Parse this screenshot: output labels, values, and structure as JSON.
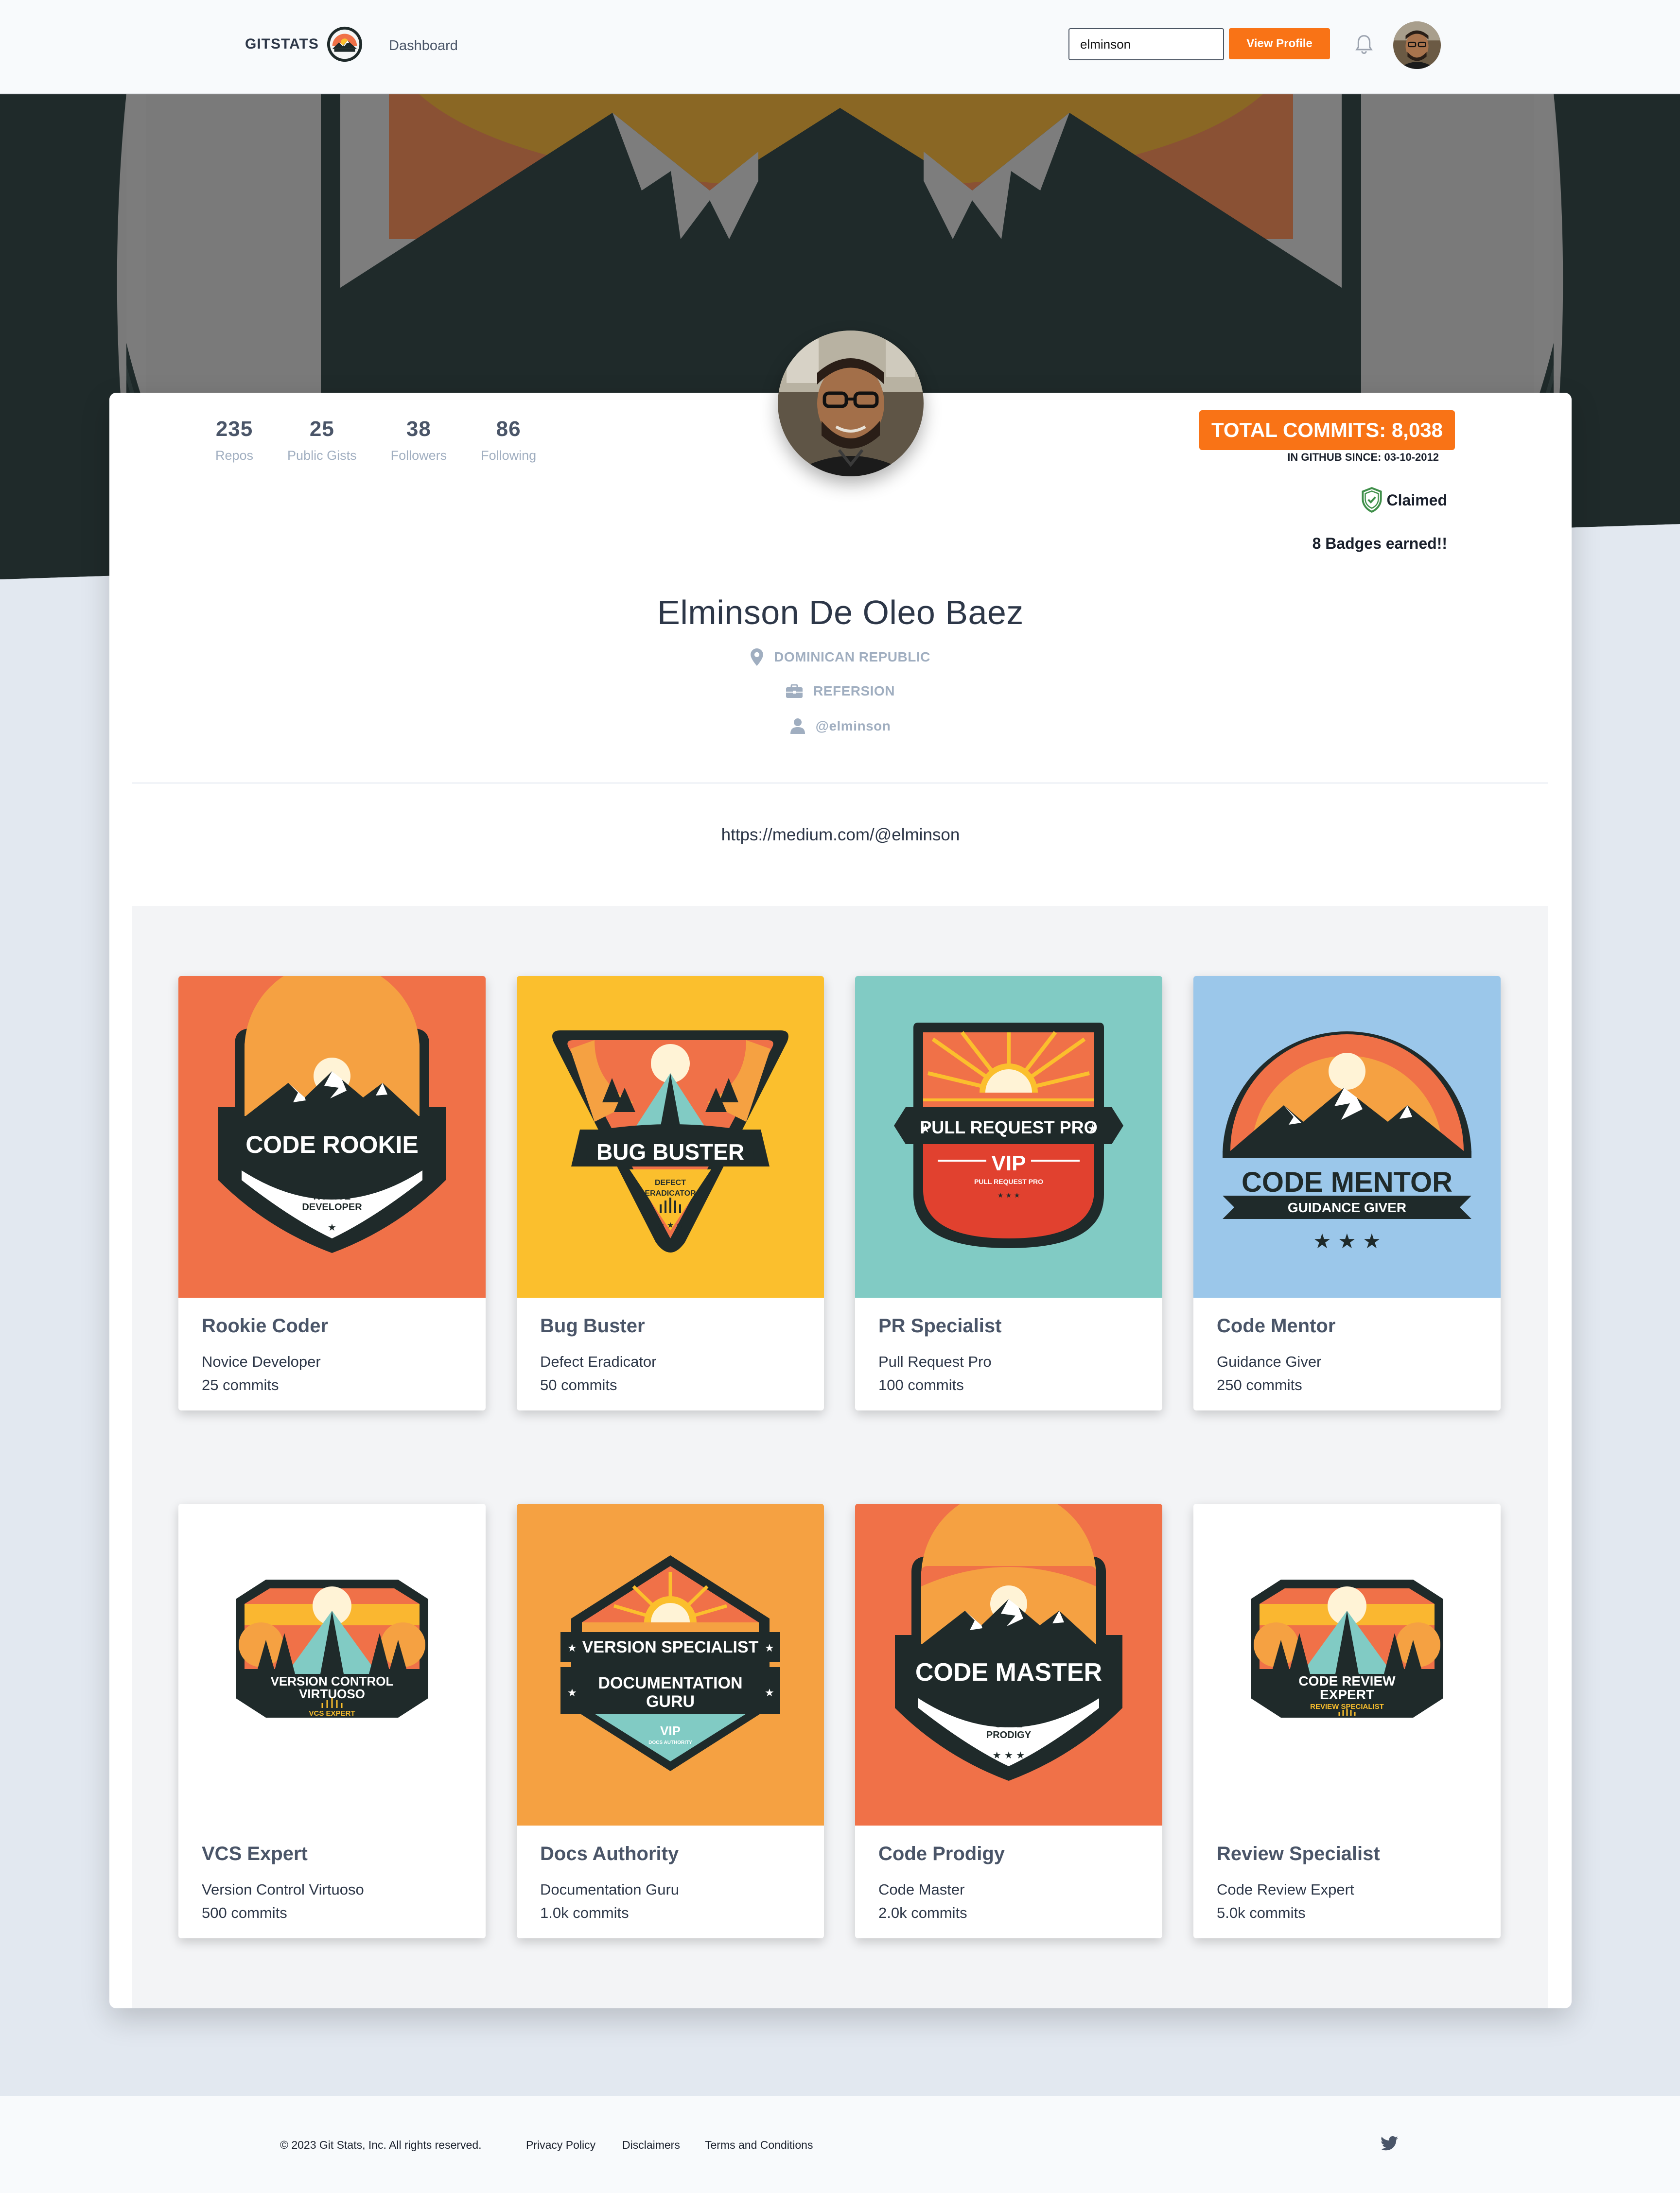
{
  "navbar": {
    "brand": "GITSTATS",
    "dashboard_link": "Dashboard",
    "search_value": "elminson",
    "view_profile_label": "View Profile"
  },
  "profile": {
    "stats": [
      {
        "value": "235",
        "label": "Repos"
      },
      {
        "value": "25",
        "label": "Public Gists"
      },
      {
        "value": "38",
        "label": "Followers"
      },
      {
        "value": "86",
        "label": "Following"
      }
    ],
    "total_commits": "TOTAL COMMITS: 8,038",
    "github_since": "IN GITHUB SINCE: 03-10-2012",
    "claimed": "Claimed",
    "badges_earned": "8 Badges earned!!",
    "name": "Elminson De Oleo Baez",
    "location": "DOMINICAN REPUBLIC",
    "company": "REFERSION",
    "username": "@elminson",
    "website": "https://medium.com/@elminson"
  },
  "badges": [
    {
      "title": "Rookie Coder",
      "subtitle": "Novice Developer",
      "commits": "25 commits",
      "bg": "#f07148",
      "art_title": "CODE ROOKIE",
      "art_sub": "NOVICE DEVELOPER"
    },
    {
      "title": "Bug Buster",
      "subtitle": "Defect Eradicator",
      "commits": "50 commits",
      "bg": "#fbbf2d",
      "art_title": "BUG BUSTER",
      "art_sub": "DEFECT ERADICATOR"
    },
    {
      "title": "PR Specialist",
      "subtitle": "Pull Request Pro",
      "commits": "100 commits",
      "bg": "#81cbc4",
      "art_title": "PULL REQUEST PRO",
      "art_sub": "VIP",
      "art_sub2": "PULL REQUEST PRO"
    },
    {
      "title": "Code Mentor",
      "subtitle": "Guidance Giver",
      "commits": "250 commits",
      "bg": "#9bc7ea",
      "art_title": "CODE MENTOR",
      "art_sub": "GUIDANCE GIVER"
    },
    {
      "title": "VCS Expert",
      "subtitle": "Version Control Virtuoso",
      "commits": "500 commits",
      "bg": "#ffffff",
      "art_title": "VERSION CONTROL",
      "art_title2": "VIRTUOSO",
      "art_sub": "VCS EXPERT"
    },
    {
      "title": "Docs Authority",
      "subtitle": "Documentation Guru",
      "commits": "1.0k commits",
      "bg": "#f5a142",
      "art_title": "VERSION SPECIALIST",
      "art_title2": "DOCUMENTATION",
      "art_title3": "GURU",
      "art_sub": "VIP"
    },
    {
      "title": "Code Prodigy",
      "subtitle": "Code Master",
      "commits": "2.0k commits",
      "bg": "#f07148",
      "art_title": "CODE MASTER",
      "art_sub": "CODE",
      "art_sub2": "PRODIGY"
    },
    {
      "title": "Review Specialist",
      "subtitle": "Code Review Expert",
      "commits": "5.0k commits",
      "bg": "#ffffff",
      "art_title": "CODE REVIEW",
      "art_title2": "EXPERT",
      "art_sub": "REVIEW SPECIALIST"
    }
  ],
  "footer": {
    "copyright": "© 2023 Git Stats, Inc. All rights reserved.",
    "privacy": "Privacy Policy",
    "disclaimers": "Disclaimers",
    "terms": "Terms and Conditions"
  },
  "colors": {
    "accent": "#f97316",
    "dark": "#1f2a2a",
    "bg": "#e2e8f0"
  },
  "icons": [
    "bell-icon",
    "map-pin-icon",
    "briefcase-icon",
    "user-icon",
    "shield-check-icon",
    "twitter-icon"
  ]
}
